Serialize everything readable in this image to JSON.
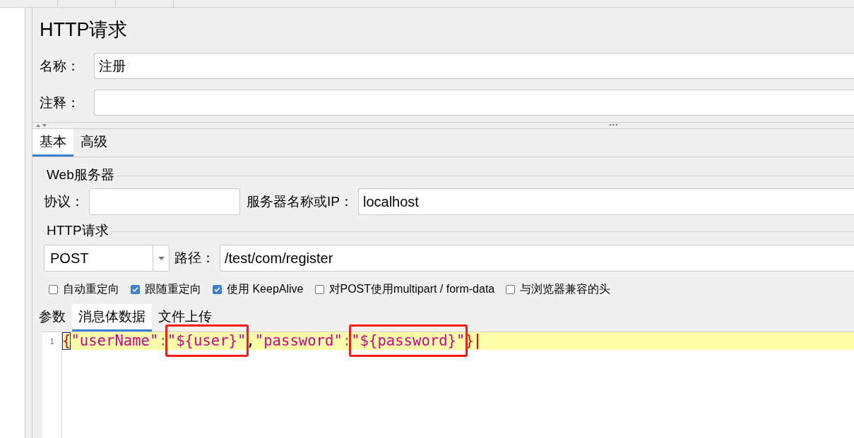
{
  "title": "HTTP请求",
  "name_field": {
    "label": "名称：",
    "value": "注册"
  },
  "comment_field": {
    "label": "注释："
  },
  "tabs": [
    {
      "label": "基本",
      "selected": true
    },
    {
      "label": "高级",
      "selected": false
    }
  ],
  "web_server": {
    "legend": "Web服务器",
    "protocol": {
      "label": "协议："
    },
    "server": {
      "label": "服务器名称或IP：",
      "value": "localhost"
    }
  },
  "http_request": {
    "legend": "HTTP请求",
    "method": {
      "value": "POST"
    },
    "path": {
      "label": "路径：",
      "value": "/test/com/register"
    },
    "options": [
      {
        "label": "自动重定向",
        "checked": false
      },
      {
        "label": "跟随重定向",
        "checked": true
      },
      {
        "label": "使用 KeepAlive",
        "checked": true
      },
      {
        "label": "对POST使用multipart / form-data",
        "checked": false
      },
      {
        "label": "与浏览器兼容的头",
        "checked": false
      }
    ]
  },
  "body_tabs": [
    {
      "label": "参数",
      "selected": false
    },
    {
      "label": "消息体数据",
      "selected": true
    },
    {
      "label": "文件上传",
      "selected": false
    }
  ],
  "editor": {
    "lines": [
      {
        "number": "1",
        "current": true,
        "caret": true,
        "tokens": [
          {
            "kind": "brace",
            "text": "{",
            "matched": true,
            "annotated": false
          },
          {
            "kind": "key",
            "text": "\"userName\"",
            "annotated": false
          },
          {
            "kind": "colon",
            "text": ":",
            "annotated": false
          },
          {
            "kind": "string",
            "text": "\"${user}\"",
            "annotated": true
          },
          {
            "kind": "comma",
            "text": ",",
            "annotated": false
          },
          {
            "kind": "key",
            "text": "\"password\"",
            "annotated": false
          },
          {
            "kind": "colon",
            "text": ":",
            "annotated": false
          },
          {
            "kind": "string",
            "text": "\"${password}\"",
            "annotated": true
          },
          {
            "kind": "brace",
            "text": "}",
            "matched": false,
            "annotated": false
          }
        ]
      }
    ]
  }
}
